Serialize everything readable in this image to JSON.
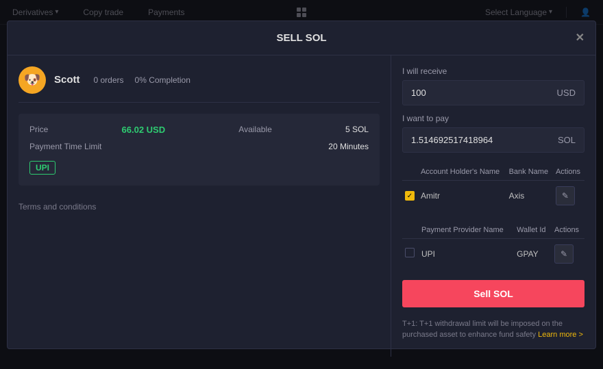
{
  "topbar": {
    "items": [
      {
        "label": "Derivatives",
        "hasDropdown": true
      },
      {
        "label": "Copy trade",
        "hasDropdown": false
      },
      {
        "label": "Payments",
        "hasDropdown": false
      }
    ],
    "right_items": [
      {
        "label": "Select Language",
        "hasDropdown": true
      }
    ]
  },
  "modal": {
    "title": "SELL SOL",
    "close_label": "✕"
  },
  "seller": {
    "name": "Scott",
    "orders": "0 orders",
    "completion": "0% Completion",
    "avatar_emoji": "🐶"
  },
  "offer": {
    "price_label": "Price",
    "price_value": "66.02 USD",
    "available_label": "Available",
    "available_value": "5 SOL",
    "payment_time_label": "Payment Time Limit",
    "payment_time_value": "20 Minutes",
    "payment_method": "UPI"
  },
  "terms": {
    "label": "Terms and conditions"
  },
  "receive": {
    "label": "I will receive",
    "value": "100",
    "unit": "USD"
  },
  "pay": {
    "label": "I want to pay",
    "value": "1.514692517418964",
    "unit": "SOL"
  },
  "bank_table": {
    "columns": [
      "",
      "Account Holder's Name",
      "Bank Name",
      "Actions"
    ],
    "rows": [
      {
        "checked": true,
        "account_holder": "Amitr",
        "bank_name": "Axis",
        "action": "edit"
      }
    ]
  },
  "wallet_table": {
    "columns": [
      "",
      "Payment Provider Name",
      "Wallet Id",
      "Actions"
    ],
    "rows": [
      {
        "checked": false,
        "provider_name": "UPI",
        "wallet_id": "GPAY",
        "action": "edit"
      }
    ]
  },
  "sell_button": {
    "label": "Sell SOL"
  },
  "disclaimer": {
    "text": "T+1: T+1 withdrawal limit will be imposed on the purchased asset to enhance fund safety ",
    "link_text": "Learn more >"
  }
}
